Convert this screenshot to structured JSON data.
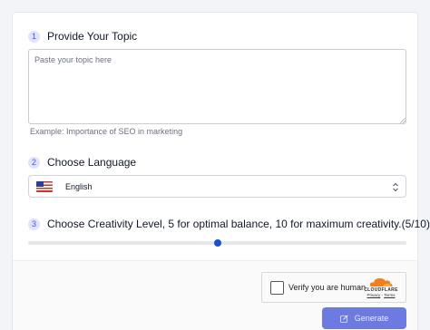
{
  "steps": [
    {
      "num": "1",
      "label": "Provide Your Topic"
    },
    {
      "num": "2",
      "label": "Choose Language"
    },
    {
      "num": "3",
      "label": "Choose Creativity Level, 5 for optimal balance, 10 for maximum creativity.(5/10)"
    }
  ],
  "topic": {
    "placeholder": "Paste your topic here",
    "value": "",
    "example": "Example:  Importance of SEO in marketing"
  },
  "language": {
    "selected": "English",
    "flag_icon": "us-flag-icon"
  },
  "creativity": {
    "value": 5,
    "min": 0,
    "max": 10
  },
  "captcha": {
    "label": "Verify you are human",
    "brand": "CLOUDFLARE",
    "privacy": "Privacy",
    "separator": "·",
    "terms": "Terms"
  },
  "generate": {
    "label": "Generate",
    "icon": "edit-icon"
  },
  "colors": {
    "accent": "#6d7ae0",
    "slider_thumb": "#1d4ed8",
    "cloudflare": "#f38020"
  }
}
